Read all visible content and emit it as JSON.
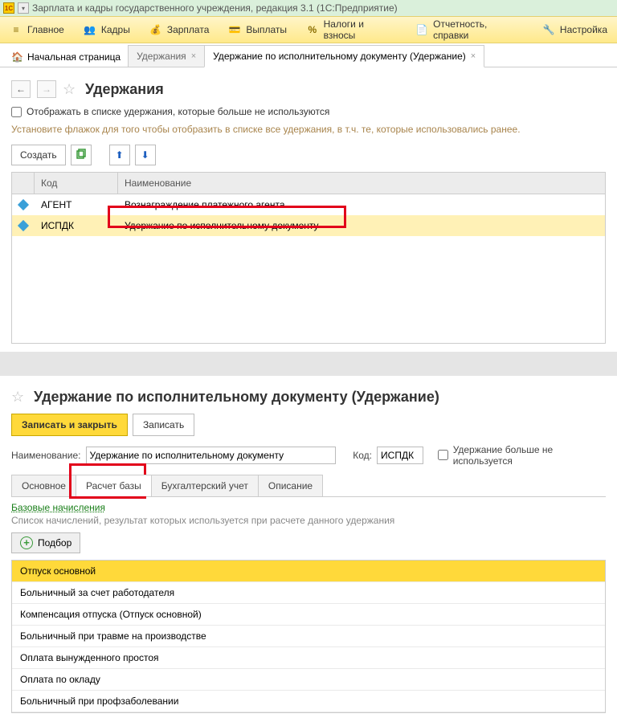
{
  "titlebar": {
    "text": "Зарплата и кадры государственного учреждения, редакция 3.1  (1С:Предприятие)"
  },
  "mainnav": {
    "items": [
      {
        "icon": "menu",
        "label": "Главное"
      },
      {
        "icon": "people",
        "label": "Кадры"
      },
      {
        "icon": "money",
        "label": "Зарплата"
      },
      {
        "icon": "card",
        "label": "Выплаты"
      },
      {
        "icon": "percent",
        "label": "Налоги и взносы"
      },
      {
        "icon": "doc",
        "label": "Отчетность, справки"
      },
      {
        "icon": "wrench",
        "label": "Настройка"
      }
    ]
  },
  "tabs": {
    "home": "Начальная страница",
    "t1": "Удержания",
    "t2": "Удержание по исполнительному документу (Удержание)"
  },
  "upper": {
    "title": "Удержания",
    "show_unused_label": "Отображать в списке удержания, которые больше не используются",
    "hint": "Установите флажок для того чтобы отобразить в списке все удержания, в т.ч. те, которые использовались ранее.",
    "create_btn": "Создать",
    "columns": {
      "code": "Код",
      "name": "Наименование"
    },
    "rows": [
      {
        "code": "АГЕНТ",
        "name": "Вознаграждение платежного агента",
        "selected": false
      },
      {
        "code": "ИСПДК",
        "name": "Удержание по исполнительному документу",
        "selected": true
      }
    ]
  },
  "lower": {
    "title": "Удержание по исполнительному документу (Удержание)",
    "write_close": "Записать и закрыть",
    "write": "Записать",
    "name_label": "Наименование:",
    "name_value": "Удержание по исполнительному документу",
    "code_label": "Код:",
    "code_value": "ИСПДК",
    "unused_label": "Удержание больше не используется",
    "tabs": [
      "Основное",
      "Расчет базы",
      "Бухгалтерский учет",
      "Описание"
    ],
    "active_tab": 1,
    "base_link": "Базовые начисления",
    "base_hint": "Список начислений, результат которых используется при расчете данного удержания",
    "podbor": "Подбор",
    "list": [
      {
        "label": "Отпуск основной",
        "selected": true
      },
      {
        "label": "Больничный за счет работодателя"
      },
      {
        "label": "Компенсация отпуска (Отпуск основной)"
      },
      {
        "label": "Больничный при травме на производстве"
      },
      {
        "label": "Оплата вынужденного простоя"
      },
      {
        "label": "Оплата по окладу"
      },
      {
        "label": "Больничный при профзаболевании"
      }
    ]
  }
}
